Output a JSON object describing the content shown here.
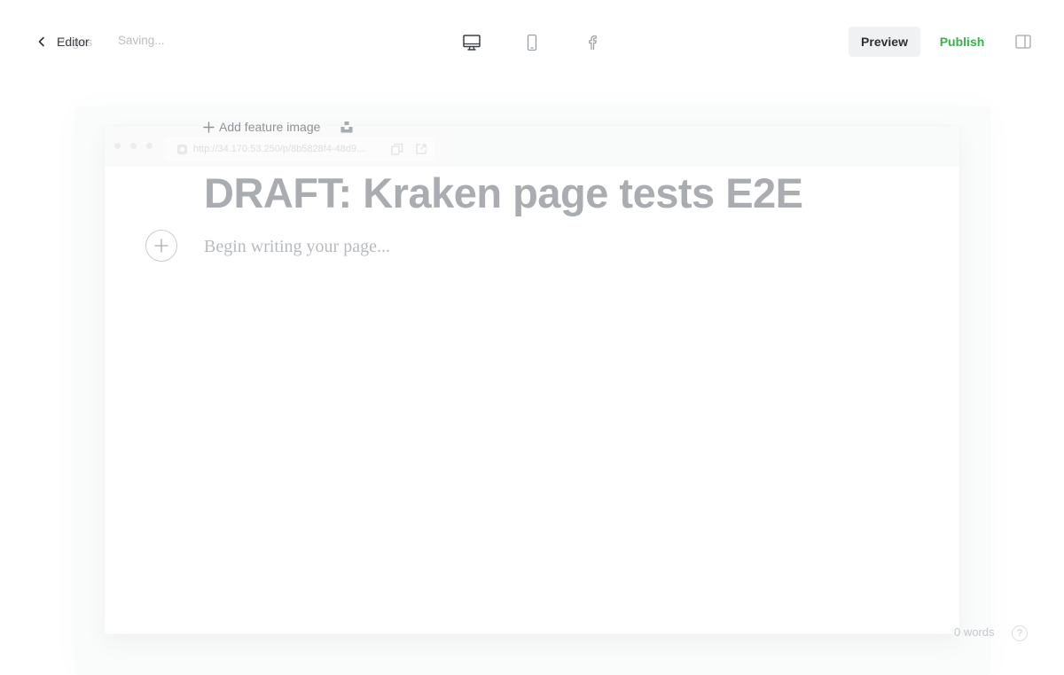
{
  "topbar": {
    "back_label": "Editor",
    "back_label_ghost": "Pages",
    "status": "Saving...",
    "devices": [
      {
        "name": "desktop",
        "icon": "desktop-icon"
      },
      {
        "name": "mobile",
        "icon": "mobile-icon"
      },
      {
        "name": "social",
        "icon": "facebook-icon"
      }
    ],
    "preview_label": "Preview",
    "publish_label": "Publish",
    "settings_icon": "sidebar-toggle-icon",
    "colors": {
      "publish": "#30b649",
      "preview_bg": "#eff1f3"
    }
  },
  "preview": {
    "url": "http://34.170.53.250/p/8b5828f4-48d9..."
  },
  "editor": {
    "add_feature_image": "Add feature image",
    "title": "DRAFT: Kraken page tests E2E",
    "body_placeholder": "Begin writing your page..."
  },
  "footer": {
    "word_count": "0 words",
    "help": "?"
  }
}
